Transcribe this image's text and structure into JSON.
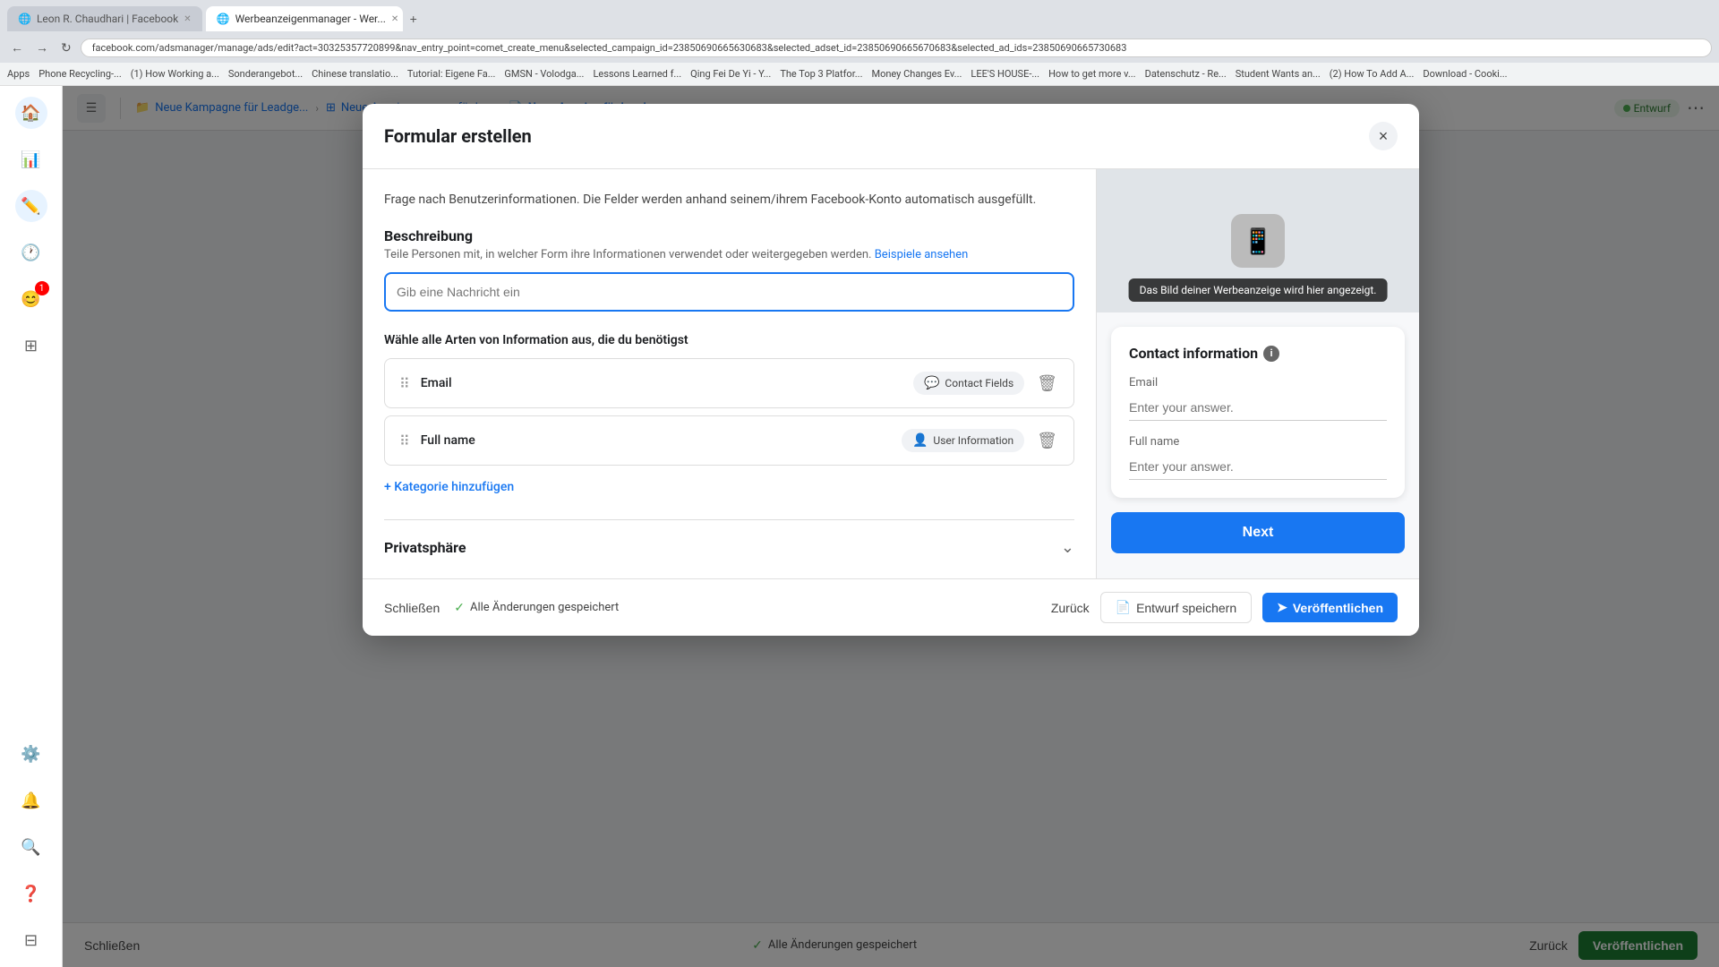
{
  "browser": {
    "tabs": [
      {
        "label": "Leon R. Chaudhari | Facebook",
        "active": false
      },
      {
        "label": "Werbeanzeigenmanager - Wer...",
        "active": true
      }
    ],
    "url": "facebook.com/adsmanager/manage/ads/edit?act=30325357720899&nav_entry_point=comet_create_menu&selected_campaign_id=23850690665630683&selected_adset_id=23850690665670683&selected_ad_ids=23850690665730683",
    "bookmarks": [
      "Apps",
      "Phone Recycling-...",
      "(1) How Working a...",
      "Sonderangebot...",
      "Chinese translatio...",
      "Tutorial: Eigene Fa...",
      "GMSN - Volodga...",
      "Lessons Learned f...",
      "Qing Fei De Yi - Y...",
      "The Top 3 Platfor...",
      "Money Changes Ev...",
      "LEE'S HOUSE-...",
      "How to get more v...",
      "Datenschutz - Re...",
      "Student Wants an...",
      "(2) How To Add A...",
      "Download - Cooki..."
    ]
  },
  "breadcrumbs": [
    {
      "label": "Neue Kampagne für Leadge...",
      "icon": "📁"
    },
    {
      "label": "Neue Anzeigengruppe für L...",
      "icon": "⊞"
    },
    {
      "label": "Neue Anzeige für Leadgene...",
      "icon": "📄"
    }
  ],
  "entwurf_label": "Entwurf",
  "modal": {
    "title": "Formular erstellen",
    "close_label": "×",
    "description_section": {
      "title": "Beschreibung",
      "subtitle": "Teile Personen mit, in welcher Form ihre Informationen verwendet oder weitergegeben werden.",
      "link_text": "Beispiele ansehen",
      "input_placeholder": "Gib eine Nachricht ein"
    },
    "info_types_title": "Wähle alle Arten von Information aus, die du benötigst",
    "fields": [
      {
        "name": "Email",
        "tag": "Contact Fields",
        "tag_icon": "💬"
      },
      {
        "name": "Full name",
        "tag": "User Information",
        "tag_icon": "👤"
      }
    ],
    "add_category_label": "+ Kategorie hinzufügen",
    "privacy_section": {
      "title": "Privatsphäre"
    },
    "page_description": "Frage nach Benutzerinformationen. Die Felder werden anhand seinem/ihrem Facebook-Konto automatisch ausgefüllt."
  },
  "preview": {
    "tooltip": "Das Bild deiner Werbeanzeige wird hier angezeigt.",
    "card_title": "Contact information",
    "fields": [
      {
        "label": "Email",
        "placeholder": "Enter your answer."
      },
      {
        "label": "Full name",
        "placeholder": "Enter your answer."
      }
    ],
    "next_button": "Next"
  },
  "footer": {
    "close_label": "Schließen",
    "saved_label": "Alle Änderungen gespeichert",
    "back_label": "Zurück",
    "save_draft_label": "Entwurf speichern",
    "publish_label": "Veröffentlichen",
    "publish_green_label": "Veröffentlichen"
  },
  "sidebar": {
    "icons": [
      "🏠",
      "📊",
      "✏️",
      "🕐",
      "😊",
      "⊞",
      "⚙️",
      "🔔",
      "🔍",
      "❓",
      "⊟"
    ]
  }
}
